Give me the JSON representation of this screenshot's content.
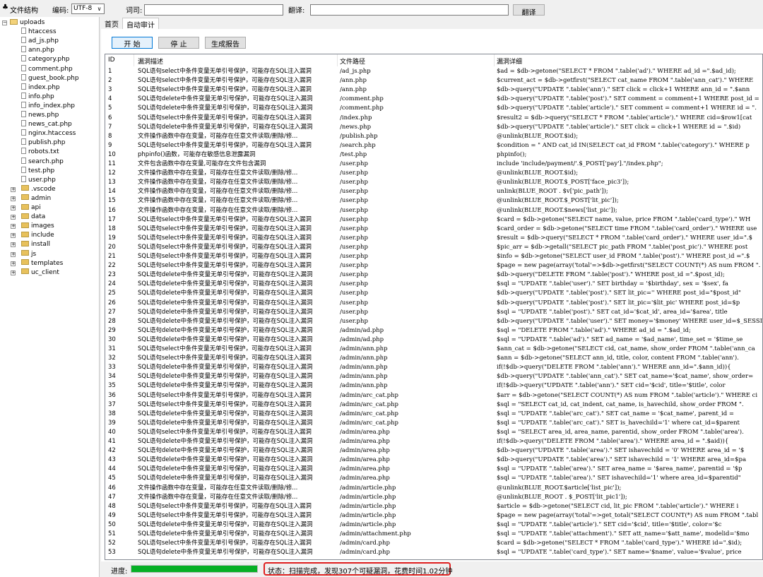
{
  "toolbar": {
    "structure_label": "文件结构",
    "encoding_label": "编码:",
    "encoding_value": "UTF-8",
    "word_label": "词司:",
    "word_value": "",
    "translate_label": "翻译:",
    "translate_value": "",
    "translate_button": "翻译"
  },
  "tree": {
    "root": "uploads",
    "files": [
      "htaccess",
      "ad_js.php",
      "ann.php",
      "category.php",
      "comment.php",
      "guest_book.php",
      "index.php",
      "info.php",
      "info_index.php",
      "news.php",
      "news_cat.php",
      "nginx.htaccess",
      "publish.php",
      "robots.txt",
      "search.php",
      "test.php",
      "user.php"
    ],
    "folders": [
      ".vscode",
      "admin",
      "api",
      "data",
      "images",
      "include",
      "install",
      "js",
      "templates",
      "uc_client"
    ]
  },
  "tabs": [
    "首页",
    "自动审计"
  ],
  "actions": {
    "start": "开 始",
    "stop": "停 止",
    "report": "生成报告"
  },
  "table": {
    "headers": {
      "id": "ID",
      "desc": "漏洞描述",
      "path": "文件路径",
      "detail": "漏洞详细"
    },
    "rows": [
      [
        "1",
        "SQL语句select中条件变量无单引号保护，可能存在SQL注入漏洞",
        "/ad_js.php",
        "$ad = $db->getone(\"SELECT * FROM \".table('ad').\" WHERE ad_id =\".$ad_id);"
      ],
      [
        "2",
        "SQL语句select中条件变量无单引号保护，可能存在SQL注入漏洞",
        "/ann.php",
        "$current_act = $db->getfirst(\"SELECT cat_name FROM \".table('ann_cat').\" WHERE"
      ],
      [
        "3",
        "SQL语句select中条件变量无单引号保护，可能存在SQL注入漏洞",
        "/ann.php",
        "$db->query(\"UPDATE \".table('ann').\" SET click = click+1 WHERE ann_id = \".$ann"
      ],
      [
        "4",
        "SQL语句delete中条件变量无单引号保护，可能存在SQL注入漏洞",
        "/comment.php",
        "$db->query(\"UPDATE \".table('post').\" SET comment = comment+1 WHERE post_id ="
      ],
      [
        "5",
        "SQL语句delete中条件变量无单引号保护，可能存在SQL注入漏洞",
        "/comment.php",
        "$db->query(\"UPDATE \".table('article').\" SET comment = comment+1 WHERE id = \"."
      ],
      [
        "6",
        "SQL语句select中条件变量无单引号保护，可能存在SQL注入漏洞",
        "/index.php",
        "$result2 = $db->query(\"SELECT * FROM \".table('article').\" WHERE cid=$row1[cat"
      ],
      [
        "7",
        "SQL语句delete中条件变量无单引号保护，可能存在SQL注入漏洞",
        "/news.php",
        "$db->query(\"UPDATE \".table('article').\" SET click = click+1 WHERE id = \".$id)"
      ],
      [
        "8",
        "文件操作函数中存在变量，可能存在任意文件读取/删除/修...",
        "/publish.php",
        "@unlink(BLUE_ROOT.$id);"
      ],
      [
        "9",
        "SQL语句select中条件变量无单引号保护，可能存在SQL注入漏洞",
        "/search.php",
        "$condition = \" AND cat_id IN(SELECT cat_id FROM \".table('category').\" WHERE p"
      ],
      [
        "10",
        "phpinfo()函数，可能存在敏感信息泄露漏洞",
        "/test.php",
        "phpinfo();"
      ],
      [
        "11",
        "文件包含函数中存在变量,可能存在文件包含漏洞",
        "/user.php",
        "include 'include/payment/'.$_POST['pay'].\"/index.php\";"
      ],
      [
        "12",
        "文件操作函数中存在变量，可能存在任意文件读取/删除/修...",
        "/user.php",
        "@unlink(BLUE_ROOT.$id);"
      ],
      [
        "13",
        "文件操作函数中存在变量，可能存在任意文件读取/删除/修...",
        "/user.php",
        "@unlink(BLUE_ROOT.$_POST['face_pic3']);"
      ],
      [
        "14",
        "文件操作函数中存在变量，可能存在任意文件读取/删除/修...",
        "/user.php",
        "unlink(BLUE_ROOT . $v['pic_path']);"
      ],
      [
        "15",
        "文件操作函数中存在变量，可能存在任意文件读取/删除/修...",
        "/user.php",
        "@unlink(BLUE_ROOT.$_POST['lit_pic']);"
      ],
      [
        "16",
        "文件操作函数中存在变量，可能存在任意文件读取/删除/修...",
        "/user.php",
        "@unlink(BLUE_ROOT.$news['list_pic']);"
      ],
      [
        "17",
        "SQL语句select中条件变量无单引号保护，可能存在SQL注入漏洞",
        "/user.php",
        "$card = $db->getone(\"SELECT name, value, price FROM \".table('card_type').\" WH"
      ],
      [
        "18",
        "SQL语句select中条件变量无单引号保护，可能存在SQL注入漏洞",
        "/user.php",
        "$card_order = $db->getone(\"SELECT time FROM \".table('card_order').\" WHERE use"
      ],
      [
        "19",
        "SQL语句select中条件变量无单引号保护，可能存在SQL注入漏洞",
        "/user.php",
        "$result = $db->query(\"SELECT * FROM \".table('card_order').\" WHERE user_id=\".$"
      ],
      [
        "20",
        "SQL语句select中条件变量无单引号保护，可能存在SQL注入漏洞",
        "/user.php",
        "$pic_arr = $db->getall(\"SELECT pic_path FROM \".table('post_pic').\" WHERE post"
      ],
      [
        "21",
        "SQL语句select中条件变量无单引号保护，可能存在SQL注入漏洞",
        "/user.php",
        "$info = $db->getone(\"SELECT user_id FROM \".table('post').\" WHERE post_id =\".$"
      ],
      [
        "22",
        "SQL语句select中条件变量无单引号保护，可能存在SQL注入漏洞",
        "/user.php",
        "$page = new page(array('total'=>$db->getfirst(\"SELECT COUNT(*) AS num FROM \"."
      ],
      [
        "23",
        "SQL语句delete中条件变量无单引号保护，可能存在SQL注入漏洞",
        "/user.php",
        "$db->query(\"DELETE FROM \".table('post').\" WHERE post_id =\".$post_id);"
      ],
      [
        "24",
        "SQL语句delete中条件变量无单引号保护，可能存在SQL注入漏洞",
        "/user.php",
        "$sql = \"UPDATE \".table('user').\" SET birthday = '$birthday', sex = '$sex', fa"
      ],
      [
        "25",
        "SQL语句delete中条件变量无单引号保护，可能存在SQL注入漏洞",
        "/user.php",
        "$db->query(\"UPDATE \".table('post').\" SET lit_pic='' WHERE post_id=\"$post_id\""
      ],
      [
        "26",
        "SQL语句delete中条件变量无单引号保护，可能存在SQL注入漏洞",
        "/user.php",
        "$db->query(\"UPDATE \".table('post').\" SET lit_pic='$lit_pic' WHERE post_id=$p"
      ],
      [
        "27",
        "SQL语句delete中条件变量无单引号保护，可能存在SQL注入漏洞",
        "/user.php",
        "$sql = \"UPDATE \".table('post').\" SET cat_id='$cat_id', area_id='$area', title"
      ],
      [
        "28",
        "SQL语句delete中条件变量无单引号保护，可能存在SQL注入漏洞",
        "/user.php",
        "$db->query(\"UPDATE \".table('user').\" SET money='$money' WHERE user_id=$_SESSI"
      ],
      [
        "29",
        "SQL语句delete中条件变量无单引号保护，可能存在SQL注入漏洞",
        "/admin/ad.php",
        "$sql = \"DELETE FROM \".table('ad').\" WHERE ad_id = \".$ad_id;"
      ],
      [
        "30",
        "SQL语句delete中条件变量无单引号保护，可能存在SQL注入漏洞",
        "/admin/ad.php",
        "$sql = \"UPDATE \".table('ad').\" SET ad_name = '$ad_name', time_set = '$time_se"
      ],
      [
        "31",
        "SQL语句select中条件变量无单引号保护，可能存在SQL注入漏洞",
        "/admin/ann.php",
        "$ann_cat = $db->getone(\"SELECT cid, cat_name, show_order FROM \".table('ann_ca"
      ],
      [
        "32",
        "SQL语句select中条件变量无单引号保护，可能存在SQL注入漏洞",
        "/admin/ann.php",
        "$ann = $db->getone(\"SELECT ann_id, title, color, content FROM \".table('ann')."
      ],
      [
        "33",
        "SQL语句delete中条件变量无单引号保护，可能存在SQL注入漏洞",
        "/admin/ann.php",
        "if(!$db->query(\"DELETE FROM \".table('ann').\" WHERE ann_id=\".$ann_id)){"
      ],
      [
        "34",
        "SQL语句delete中条件变量无单引号保护，可能存在SQL注入漏洞",
        "/admin/ann.php",
        "$db->query(\"UPDATE \".table('ann_cat').\" SET cat_name='$cat_name', show_order="
      ],
      [
        "35",
        "SQL语句delete中条件变量无单引号保护，可能存在SQL注入漏洞",
        "/admin/ann.php",
        "if(!$db->query(\"UPDATE \".table('ann').\" SET cid='$cid', title='$title', color"
      ],
      [
        "36",
        "SQL语句select中条件变量无单引号保护，可能存在SQL注入漏洞",
        "/admin/arc_cat.php",
        "$arr = $db->getone(\"SELECT COUNT(*) AS num FROM \".table('article').\" WHERE ci"
      ],
      [
        "37",
        "SQL语句select中条件变量无单引号保护，可能存在SQL注入漏洞",
        "/admin/arc_cat.php",
        "$sql = \"SELECT cat_id, cat_indent, cat_name, is_havechild, show_order FROM \"."
      ],
      [
        "38",
        "SQL语句delete中条件变量无单引号保护，可能存在SQL注入漏洞",
        "/admin/arc_cat.php",
        "$sql = \"UPDATE \".table('arc_cat').\" SET cat_name = '$cat_name', parent_id ="
      ],
      [
        "39",
        "SQL语句delete中条件变量无单引号保护，可能存在SQL注入漏洞",
        "/admin/arc_cat.php",
        "$sql = \"UPDATE \".table('arc_cat').\" SET is_havechild='1' where cat_id=$parent"
      ],
      [
        "40",
        "SQL语句select中条件变量无单引号保护，可能存在SQL注入漏洞",
        "/admin/area.php",
        "$sql = \"SELECT area_id, area_name, parentid, show_order FROM \".table('area')."
      ],
      [
        "41",
        "SQL语句delete中条件变量无单引号保护，可能存在SQL注入漏洞",
        "/admin/area.php",
        "if(!$db->query(\"DELETE FROM \".table('area').\" WHERE area_id = \".$aid)){"
      ],
      [
        "42",
        "SQL语句delete中条件变量无单引号保护，可能存在SQL注入漏洞",
        "/admin/area.php",
        "$db->query(\"UPDATE \".table('area').\" SET ishavechild = '0' WHERE area_id = '$"
      ],
      [
        "43",
        "SQL语句delete中条件变量无单引号保护，可能存在SQL注入漏洞",
        "/admin/area.php",
        "$db->query(\"UPDATE \".table('area').\" SET ishavechild = '1' WHERE area_id=$pa"
      ],
      [
        "44",
        "SQL语句delete中条件变量无单引号保护，可能存在SQL注入漏洞",
        "/admin/area.php",
        "$sql = \"UPDATE \".table('area').\" SET area_name = '$area_name', parentid = '$p"
      ],
      [
        "45",
        "SQL语句delete中条件变量无单引号保护，可能存在SQL注入漏洞",
        "/admin/area.php",
        "$sql = \"UPDATE \".table('area').\" SET ishavechild='1' where area_id=$parentid\""
      ],
      [
        "46",
        "文件操作函数中存在变量，可能存在任意文件读取/删除/修...",
        "/admin/article.php",
        "@unlink(BLUE_ROOT.$article['list_pic']);"
      ],
      [
        "47",
        "文件操作函数中存在变量，可能存在任意文件读取/删除/修...",
        "/admin/article.php",
        "@unlink(BLUE_ROOT . $_POST['lit_pic1']);"
      ],
      [
        "48",
        "SQL语句select中条件变量无单引号保护，可能存在SQL注入漏洞",
        "/admin/article.php",
        "$article = $db->getone(\"SELECT cid, lit_pic FROM \".table('article').\" WHERE i"
      ],
      [
        "49",
        "SQL语句select中条件变量无单引号保护，可能存在SQL注入漏洞",
        "/admin/article.php",
        "$page = new page(array('total'=>get_total(\"SELECT COUNT(*) AS num FROM \".tabl"
      ],
      [
        "50",
        "SQL语句delete中条件变量无单引号保护，可能存在SQL注入漏洞",
        "/admin/article.php",
        "$sql = \"UPDATE \".table('article').\" SET cid='$cid', title='$title', color='$c"
      ],
      [
        "51",
        "SQL语句delete中条件变量无单引号保护，可能存在SQL注入漏洞",
        "/admin/attachment.php",
        "$sql = \"UPDATE \".table('attachment').\" SET att_name='$att_name', modelid='$mo"
      ],
      [
        "52",
        "SQL语句select中条件变量无单引号保护，可能存在SQL注入漏洞",
        "/admin/card.php",
        "$card = $db->getone(\"SELECT * FROM \".table('card_type').\" WHERE id=\".$id);"
      ],
      [
        "53",
        "SQL语句delete中条件变量无单引号保护，可能存在SQL注入漏洞",
        "/admin/card.php",
        "$sql = \"UPDATE \".table('card_type').\" SET name='$name', value='$value', price"
      ]
    ]
  },
  "status": {
    "progress_label": "进度:",
    "progress_fraction": 1.0,
    "progress_color": "#06b025",
    "message": "状态：扫描完成，发现307个可疑漏洞，花费时间1.02分钟",
    "highlight_color": "#e02020"
  }
}
